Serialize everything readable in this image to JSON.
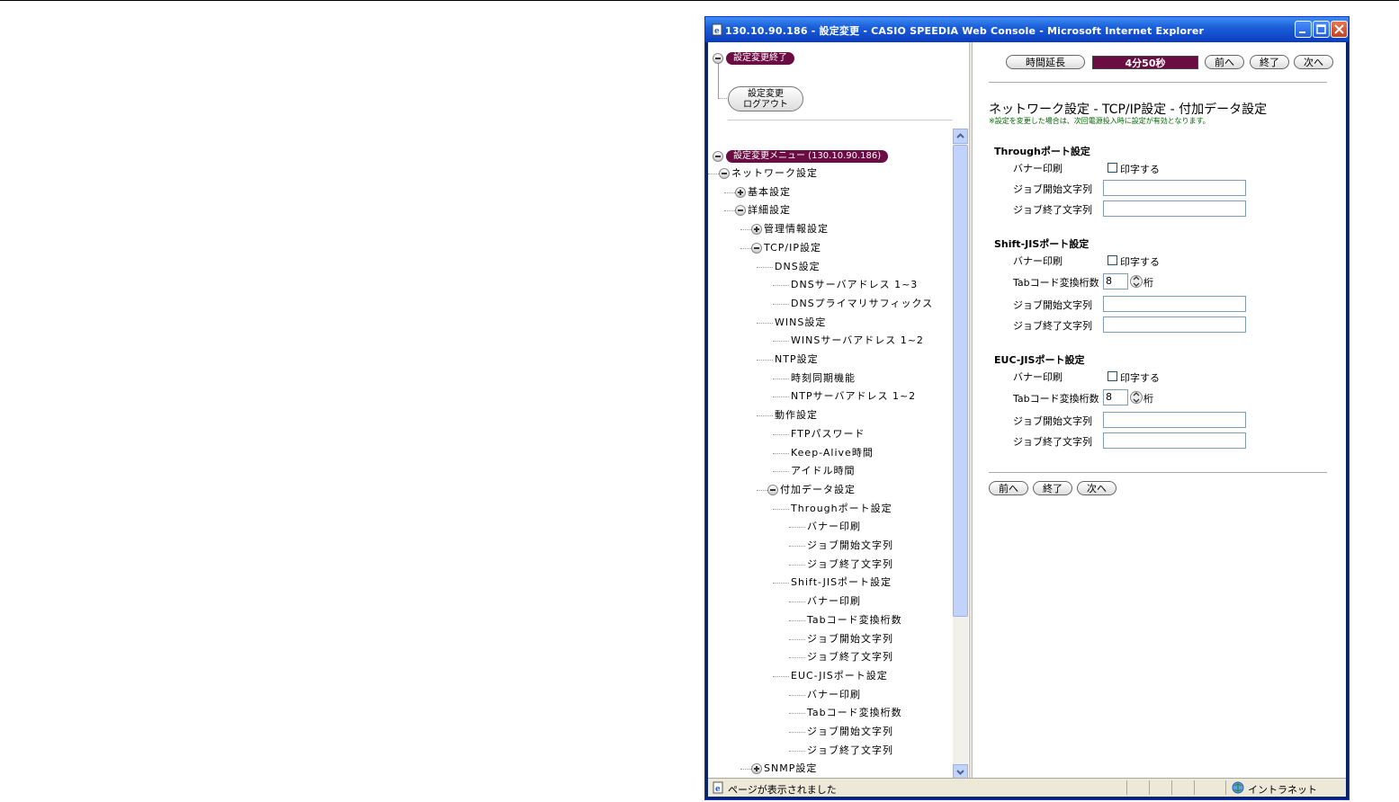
{
  "window": {
    "title": "130.10.90.186 - 設定変更 - CASIO SPEEDIA Web Console - Microsoft Internet Explorer"
  },
  "left": {
    "end_pill": "設定変更終了",
    "logout_line1": "設定変更",
    "logout_line2": "ログアウト",
    "menu_pill": "設定変更メニュー (130.10.90.186)",
    "tree": [
      {
        "label": "ネットワーク設定",
        "level": 0,
        "toggle": "minus"
      },
      {
        "label": "基本設定",
        "level": 1,
        "toggle": "plus"
      },
      {
        "label": "詳細設定",
        "level": 1,
        "toggle": "minus"
      },
      {
        "label": "管理情報設定",
        "level": 2,
        "toggle": "plus"
      },
      {
        "label": "TCP/IP設定",
        "level": 2,
        "toggle": "minus"
      },
      {
        "label": "DNS設定",
        "level": 3,
        "toggle": "none"
      },
      {
        "label": "DNSサーバアドレス 1~3",
        "level": 4,
        "toggle": "none"
      },
      {
        "label": "DNSプライマリサフィックス",
        "level": 4,
        "toggle": "none"
      },
      {
        "label": "WINS設定",
        "level": 3,
        "toggle": "none"
      },
      {
        "label": "WINSサーバアドレス 1~2",
        "level": 4,
        "toggle": "none"
      },
      {
        "label": "NTP設定",
        "level": 3,
        "toggle": "none"
      },
      {
        "label": "時刻同期機能",
        "level": 4,
        "toggle": "none"
      },
      {
        "label": "NTPサーバアドレス 1~2",
        "level": 4,
        "toggle": "none"
      },
      {
        "label": "動作設定",
        "level": 3,
        "toggle": "none"
      },
      {
        "label": "FTPパスワード",
        "level": 4,
        "toggle": "none"
      },
      {
        "label": "Keep-Alive時間",
        "level": 4,
        "toggle": "none"
      },
      {
        "label": "アイドル時間",
        "level": 4,
        "toggle": "none"
      },
      {
        "label": "付加データ設定",
        "level": 3,
        "toggle": "minus"
      },
      {
        "label": "Throughポート設定",
        "level": 4,
        "toggle": "none"
      },
      {
        "label": "バナー印刷",
        "level": 5,
        "toggle": "none"
      },
      {
        "label": "ジョブ開始文字列",
        "level": 5,
        "toggle": "none"
      },
      {
        "label": "ジョブ終了文字列",
        "level": 5,
        "toggle": "none"
      },
      {
        "label": "Shift-JISポート設定",
        "level": 4,
        "toggle": "none"
      },
      {
        "label": "バナー印刷",
        "level": 5,
        "toggle": "none"
      },
      {
        "label": "Tabコード変換桁数",
        "level": 5,
        "toggle": "none"
      },
      {
        "label": "ジョブ開始文字列",
        "level": 5,
        "toggle": "none"
      },
      {
        "label": "ジョブ終了文字列",
        "level": 5,
        "toggle": "none"
      },
      {
        "label": "EUC-JISポート設定",
        "level": 4,
        "toggle": "none"
      },
      {
        "label": "バナー印刷",
        "level": 5,
        "toggle": "none"
      },
      {
        "label": "Tabコード変換桁数",
        "level": 5,
        "toggle": "none"
      },
      {
        "label": "ジョブ開始文字列",
        "level": 5,
        "toggle": "none"
      },
      {
        "label": "ジョブ終了文字列",
        "level": 5,
        "toggle": "none"
      },
      {
        "label": "SNMP設定",
        "level": 2,
        "toggle": "plus"
      }
    ]
  },
  "right": {
    "extend_button": "時間延長",
    "timer": "4分50秒",
    "prev_button": "前へ",
    "end_button": "終了",
    "next_button": "次へ",
    "page_title": "ネットワーク設定 - TCP/IP設定 - 付加データ設定",
    "notice": "※設定を変更した場合は、次回電源投入時に設定が有効となります。",
    "sections": {
      "through": {
        "title": "Throughポート設定",
        "banner_label": "バナー印刷",
        "banner_check": "印字する",
        "job_start_label": "ジョブ開始文字列",
        "job_start_value": "",
        "job_end_label": "ジョブ終了文字列",
        "job_end_value": ""
      },
      "shiftjis": {
        "title": "Shift-JISポート設定",
        "banner_label": "バナー印刷",
        "banner_check": "印字する",
        "tab_label": "Tabコード変換桁数",
        "tab_value": "8",
        "tab_unit": "桁",
        "job_start_label": "ジョブ開始文字列",
        "job_start_value": "",
        "job_end_label": "ジョブ終了文字列",
        "job_end_value": ""
      },
      "eucjis": {
        "title": "EUC-JISポート設定",
        "banner_label": "バナー印刷",
        "banner_check": "印字する",
        "tab_label": "Tabコード変換桁数",
        "tab_value": "8",
        "tab_unit": "桁",
        "job_start_label": "ジョブ開始文字列",
        "job_start_value": "",
        "job_end_label": "ジョブ終了文字列",
        "job_end_value": ""
      }
    }
  },
  "status": {
    "text": "ページが表示されました",
    "zone": "イントラネット"
  }
}
